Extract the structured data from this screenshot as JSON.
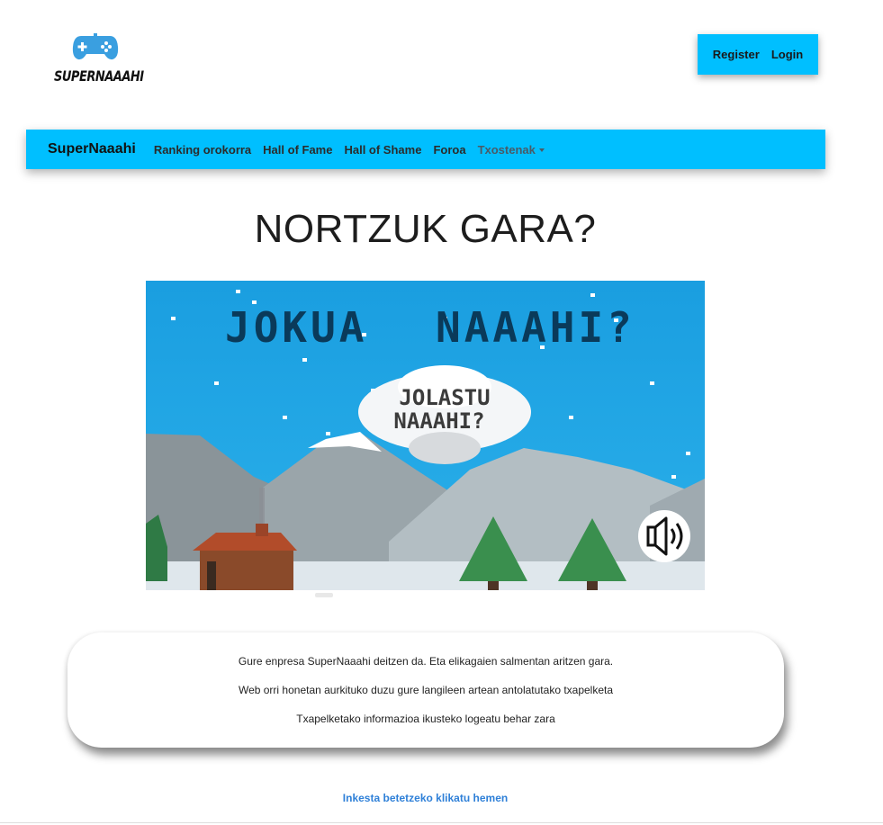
{
  "header": {
    "logo_text": "SUPERNAAAHI",
    "logo_icon": "gamepad-icon",
    "register_label": "Register",
    "login_label": "Login"
  },
  "navbar": {
    "brand": "SuperNaaahi",
    "items": [
      {
        "label": "Ranking orokorra"
      },
      {
        "label": "Hall of Fame"
      },
      {
        "label": "Hall of Shame"
      },
      {
        "label": "Foroa"
      },
      {
        "label": "Txostenak",
        "dropdown": true
      }
    ]
  },
  "main": {
    "title": "NORTZUK GARA?",
    "video": {
      "headline_left": "JOKUA",
      "headline_right": "NAAAHI?",
      "cloud_line1": "JOLASTU",
      "cloud_line2": "NAAAHI?",
      "sound_icon": "speaker-icon"
    },
    "info": [
      "Gure enpresa SuperNaaahi deitzen da. Eta elikagaien salmentan aritzen gara.",
      "Web orri honetan aurkituko duzu gure langileen artean antolatutako txapelketa",
      "Txapelketako informazioa ikusteko logeatu behar zara"
    ],
    "survey_link": "Inkesta betetzeko klikatu hemen"
  },
  "colors": {
    "accent": "#00bfff",
    "link": "#2f80d8",
    "sky": "#1a9ee0"
  }
}
